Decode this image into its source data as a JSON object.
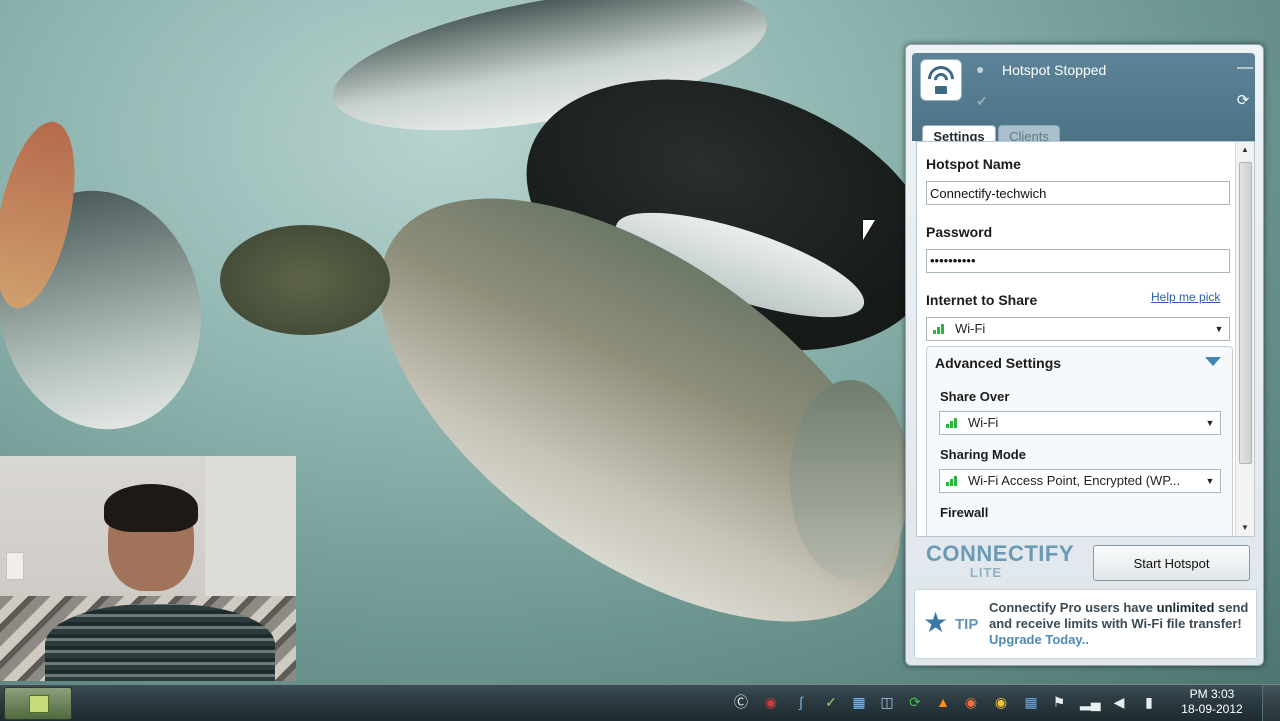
{
  "desktop": {
    "background": "underwater-salmon-wallpaper"
  },
  "connectify": {
    "status": "Hotspot Stopped",
    "icons": {
      "logo": "wifi-hotspot-logo-icon",
      "user": "user-icon",
      "check": "check-icon",
      "minimize": "minimize-icon",
      "refresh": "refresh-icon"
    },
    "tabs": [
      {
        "label": "Settings",
        "active": true
      },
      {
        "label": "Clients",
        "active": false
      }
    ],
    "settings": {
      "hotspot_name_label": "Hotspot Name",
      "hotspot_name_value": "Connectify-techwich",
      "password_label": "Password",
      "password_value": "••••••••••",
      "internet_label": "Internet to Share",
      "help_link": "Help me pick",
      "internet_value": "Wi-Fi",
      "advanced_title": "Advanced Settings",
      "share_over_label": "Share Over",
      "share_over_value": "Wi-Fi",
      "sharing_mode_label": "Sharing Mode",
      "sharing_mode_value": "Wi-Fi Access Point, Encrypted (WP...",
      "firewall_label": "Firewall"
    },
    "brand": {
      "name": "CONNECTIFY",
      "edition": "LITE"
    },
    "start_button": "Start Hotspot",
    "tip": {
      "label": "TIP",
      "part1": "Connectify Pro users have ",
      "highlight": "unlimited",
      "part2": " send and receive limits with Wi-Fi file transfer! ",
      "link": "Upgrade Today.."
    },
    "colors": {
      "header": "#5d8398",
      "accent": "#3f86b9",
      "signal": "#27b53b",
      "link": "#2a5cb8"
    }
  },
  "taskbar": {
    "clock_time": "PM 3:03",
    "clock_date": "18-09-2012",
    "tray_icons": [
      "connectify-icon",
      "network-hotspot-icon",
      "bluetooth-icon",
      "security-check-icon",
      "grid-app-icon",
      "network-share-icon",
      "sync-icon",
      "vlc-icon",
      "chrome-icon",
      "monitor-icon",
      "flag-icon",
      "signal-bars-icon",
      "volume-icon",
      "battery-icon"
    ]
  }
}
